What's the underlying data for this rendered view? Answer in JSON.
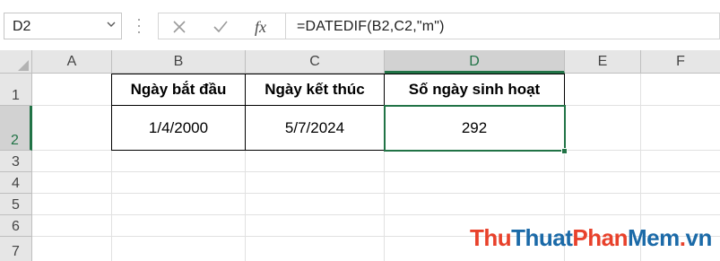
{
  "formula_bar": {
    "name_box": "D2",
    "cancel_icon": "✕",
    "enter_icon": "✓",
    "function_icon": "fx",
    "formula": "=DATEDIF(B2,C2,\"m\")"
  },
  "columns": [
    "A",
    "B",
    "C",
    "D",
    "E",
    "F"
  ],
  "rows": [
    "1",
    "2",
    "3",
    "4",
    "5",
    "6",
    "7"
  ],
  "active_cell": "D2",
  "table": {
    "headers": [
      "Ngày bắt đầu",
      "Ngày kết thúc",
      "Số ngày sinh hoạt"
    ],
    "values": [
      "1/4/2000",
      "5/7/2024",
      "292"
    ]
  },
  "watermark": {
    "parts": [
      "Thu",
      "Thuat",
      "Phan",
      "Mem",
      ".",
      "vn"
    ]
  },
  "colors": {
    "accent": "#217346",
    "watermark_red": "#e8412b",
    "watermark_blue": "#1b6aa8"
  }
}
